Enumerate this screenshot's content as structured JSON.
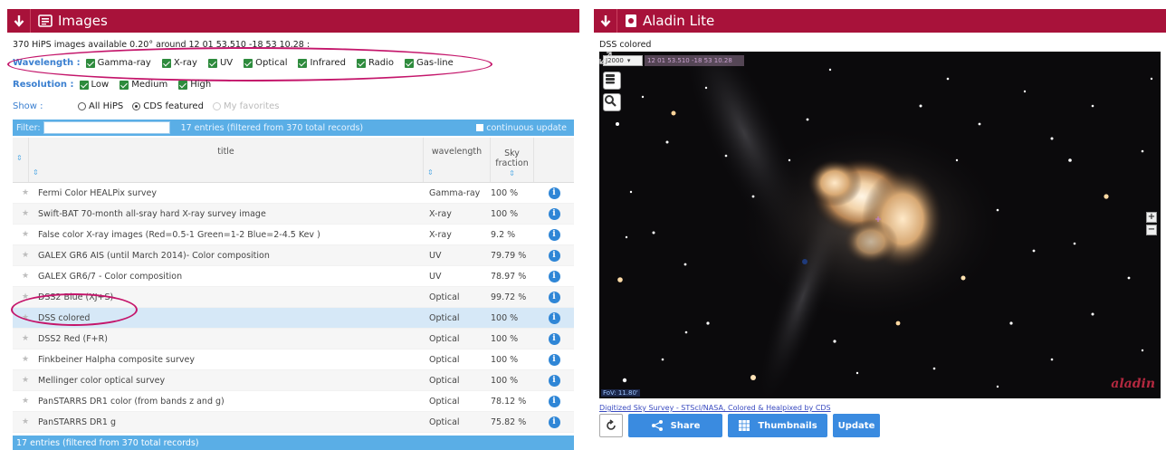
{
  "left": {
    "title": "Images",
    "info": "370 HiPS images available 0.20° around 12 01 53.510 -18 53 10.28 :",
    "wavelength_label": "Wavelength :",
    "wavelengths": [
      "Gamma-ray",
      "X-ray",
      "UV",
      "Optical",
      "Infrared",
      "Radio",
      "Gas-line"
    ],
    "resolution_label": "Resolution :",
    "resolutions": [
      "Low",
      "Medium",
      "High"
    ],
    "show_label": "Show :",
    "show_options": [
      "All HiPS",
      "CDS featured",
      "My favorites"
    ],
    "filter_label": "Filter:",
    "filter_value": "",
    "filter_count": "17 entries (filtered from 370 total records)",
    "continuous_update": "continuous update",
    "columns": {
      "title": "title",
      "wavelength": "wavelength",
      "sky_fraction_1": "Sky",
      "sky_fraction_2": "fraction"
    },
    "rows": [
      {
        "title": "Fermi Color HEALPix survey",
        "wavelength": "Gamma-ray",
        "fraction": "100 %"
      },
      {
        "title": "Swift-BAT 70-month all-sray hard X-ray survey image",
        "wavelength": "X-ray",
        "fraction": "100 %"
      },
      {
        "title": "False color X-ray images (Red=0.5-1 Green=1-2 Blue=2-4.5 Kev )",
        "wavelength": "X-ray",
        "fraction": "9.2 %"
      },
      {
        "title": "GALEX GR6 AIS (until March 2014)- Color composition",
        "wavelength": "UV",
        "fraction": "79.79 %"
      },
      {
        "title": "GALEX GR6/7 - Color composition",
        "wavelength": "UV",
        "fraction": "78.97 %"
      },
      {
        "title": "DSS2 Blue (XJ+S)",
        "wavelength": "Optical",
        "fraction": "99.72 %"
      },
      {
        "title": "DSS colored",
        "wavelength": "Optical",
        "fraction": "100 %"
      },
      {
        "title": "DSS2 Red (F+R)",
        "wavelength": "Optical",
        "fraction": "100 %"
      },
      {
        "title": "Finkbeiner Halpha composite survey",
        "wavelength": "Optical",
        "fraction": "100 %"
      },
      {
        "title": "Mellinger color optical survey",
        "wavelength": "Optical",
        "fraction": "100 %"
      },
      {
        "title": "PanSTARRS DR1 color (from bands z and g)",
        "wavelength": "Optical",
        "fraction": "78.12 %"
      },
      {
        "title": "PanSTARRS DR1 g",
        "wavelength": "Optical",
        "fraction": "75.82 %"
      }
    ],
    "footer": "17 entries (filtered from 370 total records)"
  },
  "right": {
    "title": "Aladin Lite",
    "survey_name": "DSS colored",
    "fov_select": "J2000",
    "coords": "12 01 53.510 -18 53 10.28",
    "fov_label": "FoV: 11.80'",
    "logo": "aladin",
    "credit": "Digitized Sky Survey - STScI/NASA, Colored & Healpixed by CDS",
    "buttons": {
      "share": "Share",
      "thumbnails": "Thumbnails",
      "update": "Update"
    }
  },
  "colors": {
    "header": "#a8123a",
    "accent": "#5aaee6",
    "button": "#3a8be0",
    "highlight_ellipse": "#c4166b"
  }
}
